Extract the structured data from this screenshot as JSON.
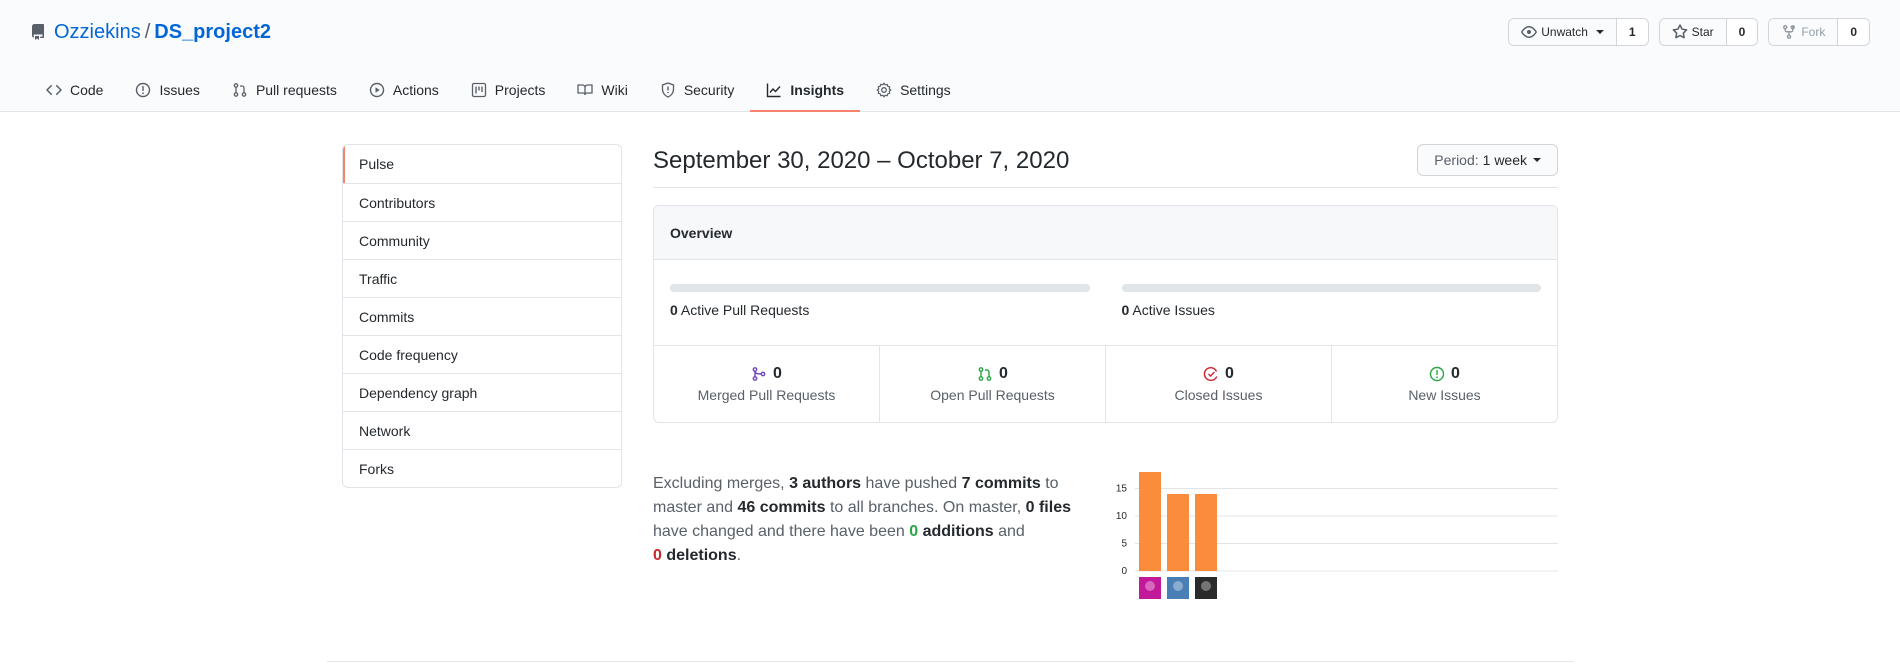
{
  "repo": {
    "owner": "Ozziekins",
    "separator": "/",
    "name": "DS_project2"
  },
  "actions": [
    {
      "label": "Unwatch",
      "count": "1",
      "icon": "eye-icon",
      "caret": true,
      "disabled": false
    },
    {
      "label": "Star",
      "count": "0",
      "icon": "star-icon",
      "caret": false,
      "disabled": false
    },
    {
      "label": "Fork",
      "count": "0",
      "icon": "fork-icon",
      "caret": false,
      "disabled": true
    }
  ],
  "tabs": [
    {
      "label": "Code",
      "icon": "code-icon",
      "active": false
    },
    {
      "label": "Issues",
      "icon": "issue-icon",
      "active": false
    },
    {
      "label": "Pull requests",
      "icon": "pull-request-icon",
      "active": false
    },
    {
      "label": "Actions",
      "icon": "play-icon",
      "active": false
    },
    {
      "label": "Projects",
      "icon": "project-icon",
      "active": false
    },
    {
      "label": "Wiki",
      "icon": "book-icon",
      "active": false
    },
    {
      "label": "Security",
      "icon": "shield-icon",
      "active": false
    },
    {
      "label": "Insights",
      "icon": "graph-icon",
      "active": true
    },
    {
      "label": "Settings",
      "icon": "gear-icon",
      "active": false
    }
  ],
  "sidebar": {
    "items": [
      {
        "label": "Pulse",
        "active": true
      },
      {
        "label": "Contributors",
        "active": false
      },
      {
        "label": "Community",
        "active": false
      },
      {
        "label": "Traffic",
        "active": false
      },
      {
        "label": "Commits",
        "active": false
      },
      {
        "label": "Code frequency",
        "active": false
      },
      {
        "label": "Dependency graph",
        "active": false
      },
      {
        "label": "Network",
        "active": false
      },
      {
        "label": "Forks",
        "active": false
      }
    ]
  },
  "pulse": {
    "date_range": "September 30, 2020 – October 7, 2020",
    "period_label": "Period:",
    "period_value": "1 week",
    "overview": {
      "title": "Overview",
      "active_prs_count": "0",
      "active_prs_label": "Active Pull Requests",
      "active_issues_count": "0",
      "active_issues_label": "Active Issues",
      "stats": [
        {
          "count": "0",
          "label": "Merged Pull Requests",
          "icon": "merged-icon",
          "color": "#6f42c1"
        },
        {
          "count": "0",
          "label": "Open Pull Requests",
          "icon": "pull-request-icon",
          "color": "#28a745"
        },
        {
          "count": "0",
          "label": "Closed Issues",
          "icon": "issue-closed-icon",
          "color": "#cb2431"
        },
        {
          "count": "0",
          "label": "New Issues",
          "icon": "issue-opened-icon",
          "color": "#28a745"
        }
      ]
    },
    "summary": {
      "t1": "Excluding merges, ",
      "authors": "3 authors",
      "t2": " have pushed ",
      "commits_master": "7 commits",
      "t3": " to master and ",
      "commits_all": "46 commits",
      "t4": " to all branches. On master, ",
      "files": "0 files",
      "t5": " have changed and there have been ",
      "additions_count": "0",
      "additions_word": " additions",
      "t6": " and ",
      "deletions_count": "0",
      "deletions_word": " deletions",
      "t7": "."
    }
  },
  "chart_data": {
    "type": "bar",
    "categories": [
      "author-1",
      "author-2",
      "author-3"
    ],
    "values": [
      18,
      14,
      14
    ],
    "yticks": [
      0,
      5,
      10,
      15
    ],
    "ylim": [
      0,
      18
    ],
    "bar_color": "#fb8c3c",
    "avatar_colors": [
      "#c2189a",
      "#4a7fb5",
      "#2a2a2a"
    ]
  }
}
